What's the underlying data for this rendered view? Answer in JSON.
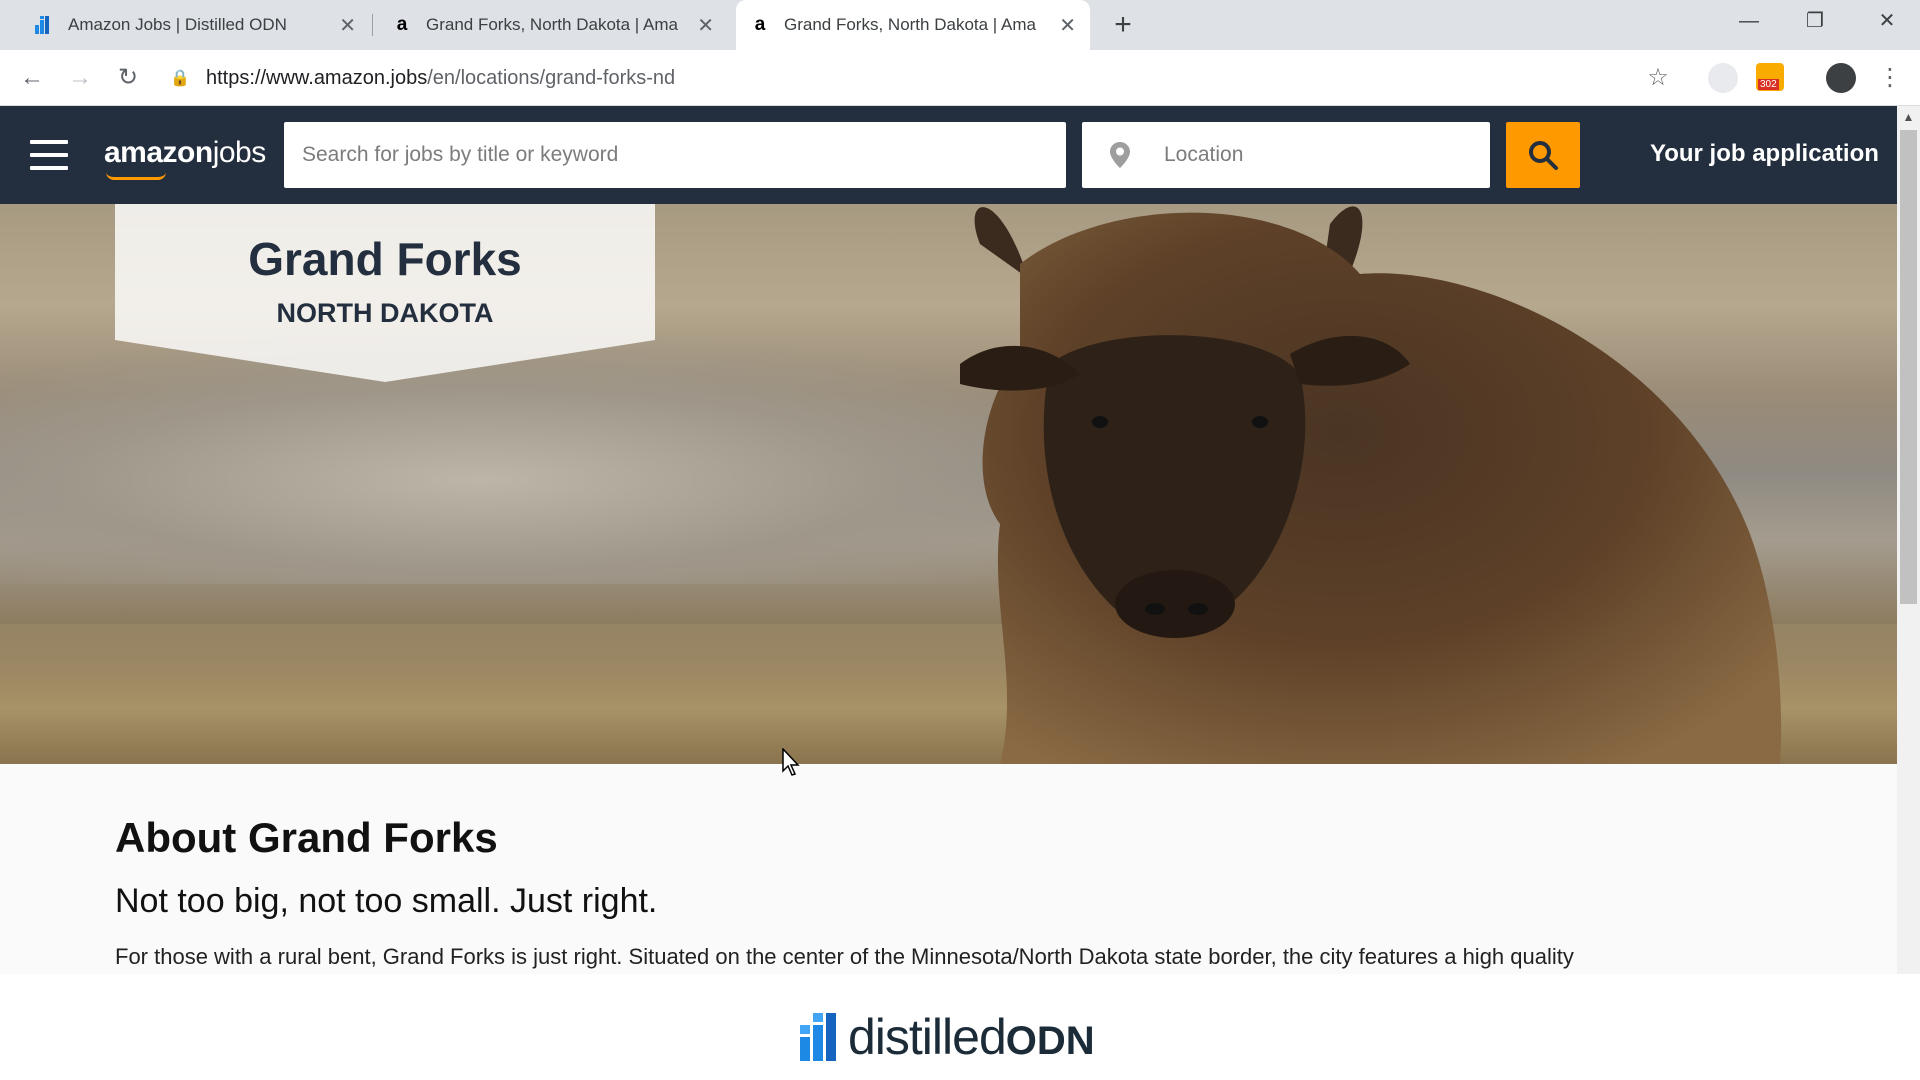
{
  "browser": {
    "tabs": [
      {
        "title": "Amazon Jobs | Distilled ODN",
        "favicon": "distilled-odn-icon"
      },
      {
        "title": "Grand Forks, North Dakota | Ama",
        "favicon": "amazon-a-icon"
      },
      {
        "title": "Grand Forks, North Dakota | Ama",
        "favicon": "amazon-a-icon"
      }
    ],
    "url_host": "https://www.amazon.jobs",
    "url_path": "/en/locations/grand-forks-nd",
    "extension_badge": "302"
  },
  "header": {
    "logo_amazon": "amazon",
    "logo_jobs": "jobs",
    "search_placeholder": "Search for jobs by title or keyword",
    "location_placeholder": "Location",
    "your_application": "Your job application",
    "accent_color": "#ff9900",
    "bar_color": "#232f3e"
  },
  "hero": {
    "city": "Grand Forks",
    "state": "NORTH DAKOTA"
  },
  "about": {
    "heading": "About Grand Forks",
    "subheading": "Not too big, not too small. Just right.",
    "paragraph": "For those with a rural bent, Grand Forks is just right. Situated on the center of the Minnesota/North Dakota state border, the city features a high quality"
  },
  "footer": {
    "brand_main": "distilled",
    "brand_suffix": "ODN"
  }
}
